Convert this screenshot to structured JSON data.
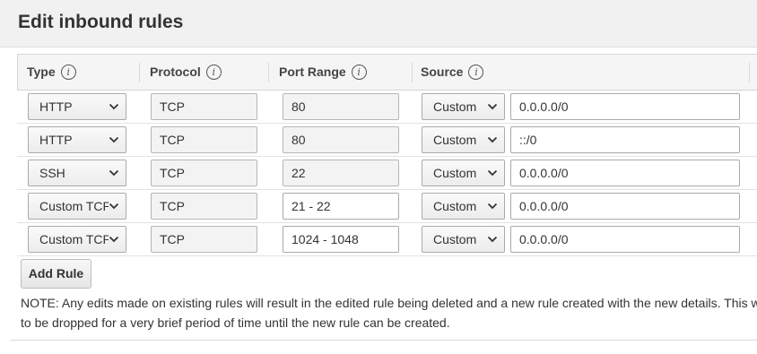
{
  "dialog": {
    "title": "Edit inbound rules"
  },
  "table": {
    "headers": {
      "type": "Type",
      "protocol": "Protocol",
      "port_range": "Port Range",
      "source": "Source"
    },
    "info_glyph": "i",
    "rows": [
      {
        "type": "HTTP",
        "protocol": "TCP",
        "port_range": "80",
        "source_mode": "Custom",
        "source_cidr": "0.0.0.0/0"
      },
      {
        "type": "HTTP",
        "protocol": "TCP",
        "port_range": "80",
        "source_mode": "Custom",
        "source_cidr": "::/0"
      },
      {
        "type": "SSH",
        "protocol": "TCP",
        "port_range": "22",
        "source_mode": "Custom",
        "source_cidr": "0.0.0.0/0"
      },
      {
        "type": "Custom TCP",
        "protocol": "TCP",
        "port_range": "21 - 22",
        "source_mode": "Custom",
        "source_cidr": "0.0.0.0/0"
      },
      {
        "type": "Custom TCP",
        "protocol": "TCP",
        "port_range": "1024 - 1048",
        "source_mode": "Custom",
        "source_cidr": "0.0.0.0/0"
      }
    ]
  },
  "actions": {
    "add_rule_label": "Add Rule"
  },
  "note": {
    "line1": "NOTE: Any edits made on existing rules will result in the edited rule being deleted and a new rule created with the new details. This will cause",
    "line2": "to be dropped for a very brief period of time until the new rule can be created."
  },
  "icons": {
    "info": "info-icon",
    "dropdown": "chevron-down-icon"
  },
  "colors": {
    "header_bg": "#f1f1f1",
    "table_header_bg": "#f5f5f5",
    "readonly_field_bg": "#f3f3f3",
    "text": "#333333"
  }
}
